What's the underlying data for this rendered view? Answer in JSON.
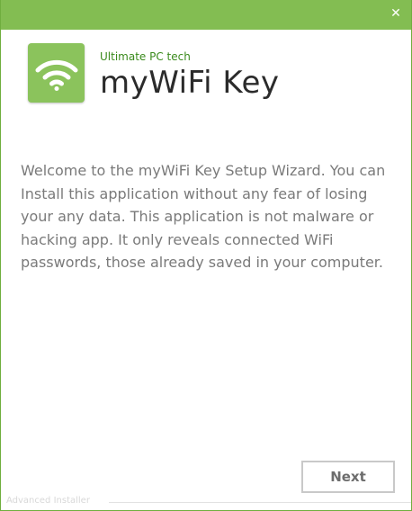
{
  "titlebar": {
    "close_glyph": "✕",
    "accent_color": "#83bd52"
  },
  "header": {
    "icon": "wifi-icon",
    "company": "Ultimate PC tech",
    "app_name": "myWiFi Key"
  },
  "main": {
    "welcome_text": "Welcome to the myWiFi Key Setup Wizard. You can Install this application without any fear of losing your any data. This application is not malware or hacking app. It only reveals connected WiFi passwords, those already saved in your computer."
  },
  "footer": {
    "brand": "Advanced Installer",
    "next_label": "Next"
  }
}
